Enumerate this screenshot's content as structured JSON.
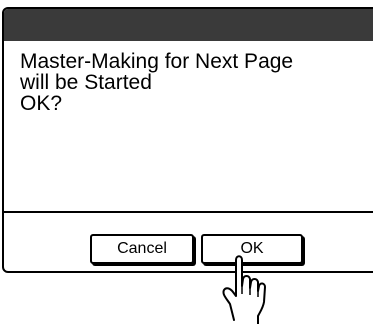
{
  "dialog": {
    "message": "Master-Making for Next Page\nwill be Started\nOK?"
  },
  "buttons": {
    "cancel_label": "Cancel",
    "ok_label": "OK"
  },
  "pointer": {
    "icon": "hand-pointer-icon"
  },
  "colors": {
    "title_bar": "#3a3a3a",
    "border": "#000000",
    "background": "#ffffff"
  }
}
